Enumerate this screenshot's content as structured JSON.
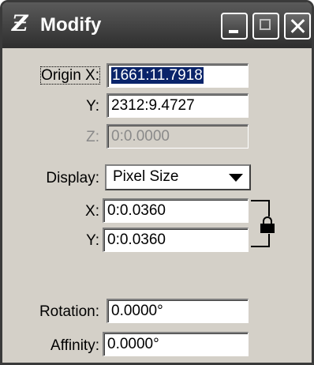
{
  "window": {
    "title": "Modify",
    "logo_glyph": "Ƶ",
    "controls": {
      "minimize": "minimize",
      "maximize": "maximize",
      "close": "close"
    }
  },
  "origin": {
    "x_label": "Origin X:",
    "x_value": "1661:11.7918",
    "y_label": "Y:",
    "y_value": "2312:9.4727",
    "z_label": "Z:",
    "z_value": "0:0.0000"
  },
  "display": {
    "label": "Display:",
    "selected": "Pixel Size",
    "x_label": "X:",
    "x_value": "0:0.0360",
    "y_label": "Y:",
    "y_value": "0:0.0360",
    "lock_icon": "lock-icon"
  },
  "rotation": {
    "label": "Rotation:",
    "value": "0.0000°"
  },
  "affinity": {
    "label": "Affinity:",
    "value": "0.0000°"
  }
}
